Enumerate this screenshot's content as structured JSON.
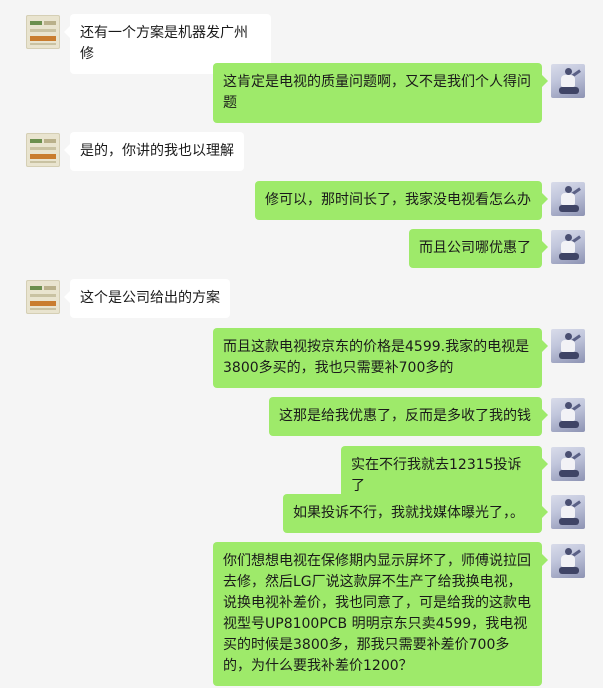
{
  "colors": {
    "background": "#f5f5f5",
    "incoming_bubble": "#ffffff",
    "outgoing_bubble": "#9eea6a"
  },
  "messages": [
    {
      "side": "left",
      "avatar_icon": "brand-avatar-icon",
      "text": "还有一个方案是机器发广州修"
    },
    {
      "side": "right",
      "avatar_icon": "user-avatar-icon",
      "text": "这肯定是电视的质量问题啊，又不是我们个人得问题"
    },
    {
      "side": "left",
      "avatar_icon": "brand-avatar-icon",
      "text": "是的，你讲的我也以理解"
    },
    {
      "side": "right",
      "avatar_icon": "user-avatar-icon",
      "text": "修可以，那时间长了，我家没电视看怎么办"
    },
    {
      "side": "right",
      "avatar_icon": "user-avatar-icon",
      "text": "而且公司哪优惠了"
    },
    {
      "side": "left",
      "avatar_icon": "brand-avatar-icon",
      "text": "这个是公司给出的方案"
    },
    {
      "side": "right",
      "avatar_icon": "user-avatar-icon",
      "text": "而且这款电视按京东的价格是4599.我家的电视是3800多买的，我也只需要补700多的"
    },
    {
      "side": "right",
      "avatar_icon": "user-avatar-icon",
      "text": "这那是给我优惠了，反而是多收了我的钱"
    },
    {
      "side": "right",
      "avatar_icon": "user-avatar-icon",
      "text": "实在不行我就去12315投诉了"
    },
    {
      "side": "right",
      "avatar_icon": "user-avatar-icon",
      "text": "如果投诉不行，我就找媒体曝光了，。"
    },
    {
      "side": "right",
      "avatar_icon": "user-avatar-icon",
      "text": "你们想想电视在保修期内显示屏坏了，师傅说拉回去修，然后LG厂说这款屏不生产了给我换电视，说换电视补差价，我也同意了，可是给我的这款电视型号UP8100PCB 明明京东只卖4599，我电视买的时候是3800多，那我只需要补差价700多的，为什么要我补差价1200？"
    }
  ]
}
